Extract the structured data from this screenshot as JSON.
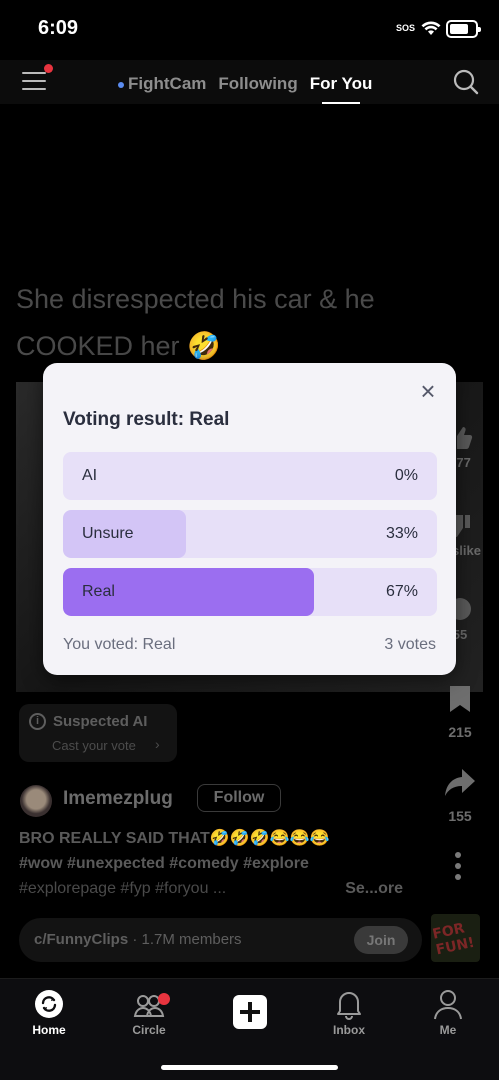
{
  "status_bar": {
    "time": "6:09",
    "sos": "SOS"
  },
  "top_nav": {
    "tabs": [
      {
        "label": "FightCam",
        "live": true,
        "active": false
      },
      {
        "label": "Following",
        "active": false
      },
      {
        "label": "For You",
        "active": true
      }
    ]
  },
  "post": {
    "caption": "She disrespected his car & he COOKED her 🤣",
    "side_actions": {
      "likes": "677",
      "dislike_label": "Dislike",
      "comments": "55",
      "bookmarks": "215",
      "shares": "155"
    },
    "suspected_badge": {
      "title": "Suspected AI",
      "subtitle": "Cast your vote"
    },
    "author": {
      "name": "Imemezplug",
      "follow_label": "Follow"
    },
    "description": {
      "line1": "BRO REALLY SAID THAT🤣🤣🤣😂😂😂",
      "line2": "#wow #unexpected #comedy #explore",
      "line3": "#explorepage #fyp #foryou ...",
      "see_more": "Se...ore"
    },
    "community": {
      "name": "c/FunnyClips",
      "members": "· 1.7M members",
      "join_label": "Join",
      "thumb_text": "FOR FUN!"
    }
  },
  "modal": {
    "title": "Voting result: Real",
    "options": [
      {
        "label": "AI",
        "percent_text": "0%",
        "fraction": 0.0
      },
      {
        "label": "Unsure",
        "percent_text": "33%",
        "fraction": 0.33
      },
      {
        "label": "Real",
        "percent_text": "67%",
        "fraction": 0.67
      }
    ],
    "you_voted": "You voted: Real",
    "total_votes": "3 votes",
    "colors": {
      "bar_bg": "#e7e0f8",
      "unsure_fill": "#d3c5f6",
      "real_fill": "#9b6ef0"
    }
  },
  "bottom_nav": {
    "items": [
      {
        "label": "Home",
        "active": true
      },
      {
        "label": "Circle",
        "badge": true
      },
      {
        "label": "Create"
      },
      {
        "label": "Inbox"
      },
      {
        "label": "Me"
      }
    ]
  }
}
